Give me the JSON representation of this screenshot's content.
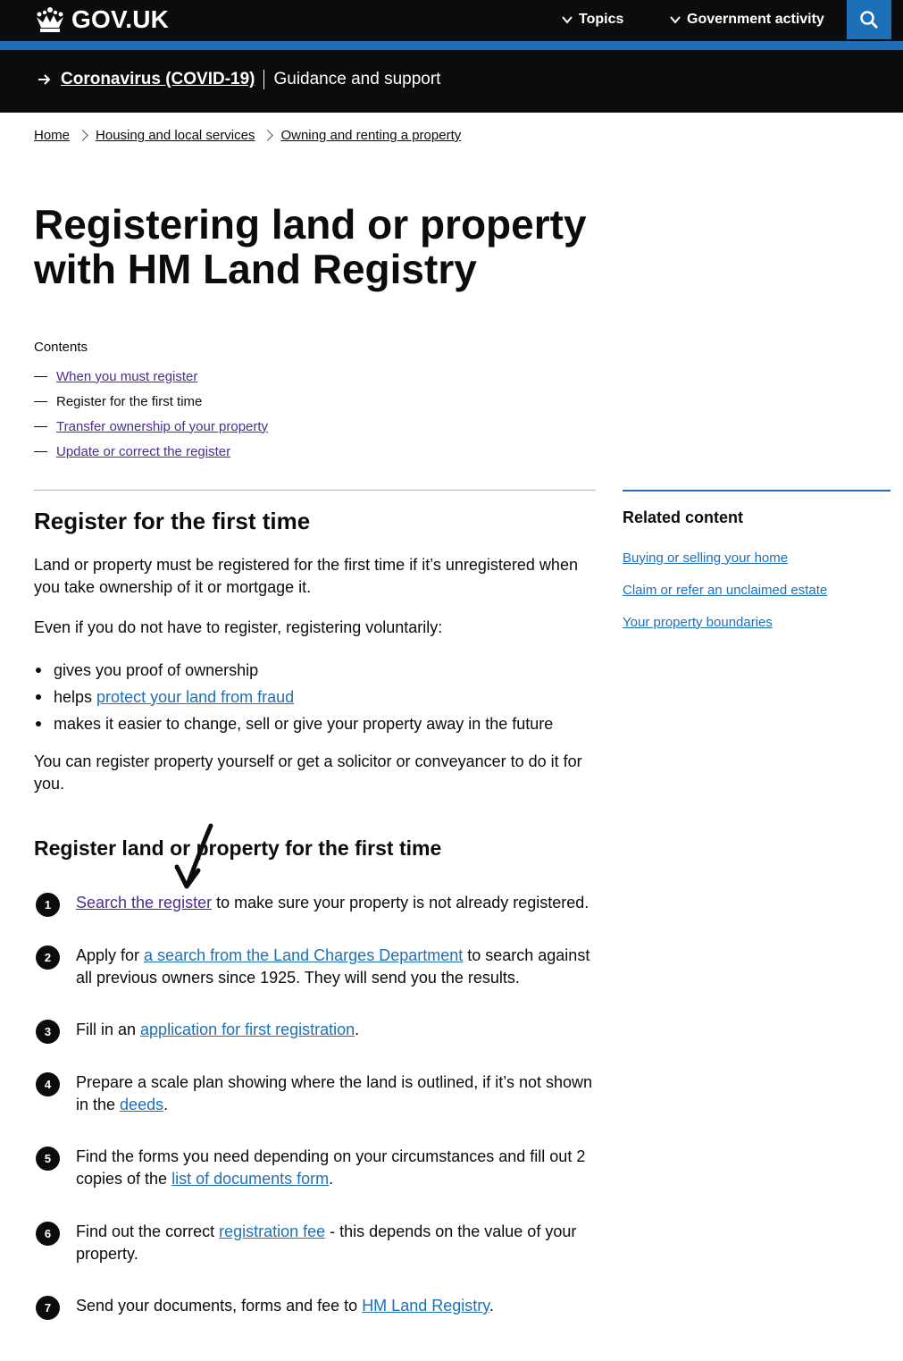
{
  "header": {
    "logo_text": "GOV.UK",
    "nav": [
      {
        "label": "Topics"
      },
      {
        "label": "Government activity"
      }
    ],
    "search_icon": "search-icon"
  },
  "covid_banner": {
    "link": "Coronavirus (COVID-19)",
    "text": "Guidance and support"
  },
  "breadcrumb": [
    "Home",
    "Housing and local services",
    "Owning and renting a property"
  ],
  "page_title": "Registering land or property with HM Land Registry",
  "contents": {
    "title": "Contents",
    "items": [
      {
        "label": "When you must register",
        "current": false
      },
      {
        "label": "Register for the first time",
        "current": true
      },
      {
        "label": "Transfer ownership of your property",
        "current": false
      },
      {
        "label": "Update or correct the register",
        "current": false
      }
    ]
  },
  "section": {
    "heading": "Register for the first time",
    "intro": "Land or property must be registered for the first time if it’s unregistered when you take ownership of it or mortgage it.",
    "voluntary": "Even if you do not have to register, registering voluntarily:",
    "bullets": {
      "b1": "gives you proof of ownership",
      "b2_pre": "helps ",
      "b2_link": "protect your land from fraud",
      "b3": "makes it easier to change, sell or give your property away in the future"
    },
    "yourself": "You can register property yourself or get a solicitor or conveyancer to do it for you.",
    "subheading": "Register land or property for the first time",
    "steps": [
      {
        "num": "1",
        "pre": "",
        "link": "Search the register",
        "post": " to make sure your property is not already registered."
      },
      {
        "num": "2",
        "pre": "Apply for ",
        "link": "a search from the Land Charges Department",
        "post": " to search against all previous owners since 1925. They will send you the results."
      },
      {
        "num": "3",
        "pre": "Fill in an ",
        "link": "application for first registration",
        "post": "."
      },
      {
        "num": "4",
        "pre": "Prepare a scale plan showing where the land is outlined, if it’s not shown in the ",
        "link": "deeds",
        "post": "."
      },
      {
        "num": "5",
        "pre": "Find the forms you need depending on your circumstances and fill out 2 copies of the ",
        "link": "list of documents form",
        "post": "."
      },
      {
        "num": "6",
        "pre": "Find out the correct ",
        "link": "registration fee",
        "post": " - this depends on the value of your property."
      },
      {
        "num": "7",
        "pre": "Send your documents, forms and fee to ",
        "link": "HM Land Registry",
        "post": "."
      }
    ]
  },
  "related": {
    "title": "Related content",
    "links": [
      "Buying or selling your home",
      "Claim or refer an unclaimed estate",
      "Your property boundaries"
    ]
  },
  "colors": {
    "brand_blue": "#1d70b8",
    "header_black": "#0b0c0c",
    "visited": "#4c2c92"
  }
}
